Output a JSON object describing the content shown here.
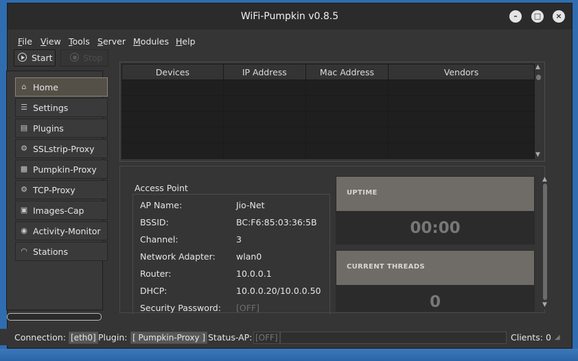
{
  "window": {
    "title": "WiFi-Pumpkin v0.8.5"
  },
  "window_controls": {
    "minimize": "–",
    "maximize": "□",
    "close": "×"
  },
  "menu": [
    {
      "label": "File",
      "accel": "F",
      "rest": "ile"
    },
    {
      "label": "View",
      "accel": "V",
      "rest": "iew"
    },
    {
      "label": "Tools",
      "accel": "T",
      "rest": "ools"
    },
    {
      "label": "Server",
      "accel": "S",
      "rest": "erver"
    },
    {
      "label": "Modules",
      "accel": "M",
      "rest": "odules"
    },
    {
      "label": "Help",
      "accel": "H",
      "rest": "elp"
    }
  ],
  "toolbar": {
    "start_label": "Start",
    "stop_label": "Stop"
  },
  "sidebar": {
    "items": [
      {
        "label": "Home",
        "icon": "home-icon",
        "glyph": "⌂",
        "active": true
      },
      {
        "label": "Settings",
        "icon": "settings-icon",
        "glyph": "☰"
      },
      {
        "label": "Plugins",
        "icon": "plugins-icon",
        "glyph": "▤"
      },
      {
        "label": "SSLstrip-Proxy",
        "icon": "sslstrip-icon",
        "glyph": "⚙"
      },
      {
        "label": "Pumpkin-Proxy",
        "icon": "pumpkin-proxy-icon",
        "glyph": "▦"
      },
      {
        "label": "TCP-Proxy",
        "icon": "tcp-proxy-icon",
        "glyph": "⚙"
      },
      {
        "label": "Images-Cap",
        "icon": "images-cap-icon",
        "glyph": "▣"
      },
      {
        "label": "Activity-Monitor",
        "icon": "activity-monitor-icon",
        "glyph": "◉"
      },
      {
        "label": "Stations",
        "icon": "stations-icon",
        "glyph": "◠"
      }
    ]
  },
  "devices_table": {
    "columns": [
      "Devices",
      "IP Address",
      "Mac Address",
      "Vendors"
    ],
    "rows": [
      [
        "",
        "",
        "",
        ""
      ],
      [
        "",
        "",
        "",
        ""
      ],
      [
        "",
        "",
        "",
        ""
      ],
      [
        "",
        "",
        "",
        ""
      ],
      [
        "",
        "",
        "",
        ""
      ]
    ]
  },
  "access_point": {
    "title": "Access Point",
    "fields": [
      {
        "label": "AP Name:",
        "value": "Jio-Net"
      },
      {
        "label": "BSSID:",
        "value": "BC:F6:85:03:36:5B"
      },
      {
        "label": "Channel:",
        "value": "3"
      },
      {
        "label": "Network Adapter:",
        "value": "wlan0"
      },
      {
        "label": "Router:",
        "value": "10.0.0.1"
      },
      {
        "label": "DHCP:",
        "value": "10.0.0.20/10.0.0.50"
      },
      {
        "label": "Security Password:",
        "value": "[OFF]"
      }
    ]
  },
  "uptime": {
    "title": "UPTIME",
    "value": "00:00"
  },
  "threads": {
    "title": "CURRENT THREADS",
    "value": "0"
  },
  "statusbar": {
    "connection_label": "Connection:",
    "connection_value": "[eth0]",
    "plugin_label": "Plugin:",
    "plugin_value": "[ Pumpkin-Proxy ]",
    "status_ap_label": "Status-AP:",
    "status_ap_value": "[OFF]",
    "clients_label": "Clients:",
    "clients_value": "0"
  },
  "colors": {
    "window_bg": "#353535",
    "active_nav": "#555047",
    "card_header": "#6f6b66",
    "desktop": "#2f6db0"
  }
}
